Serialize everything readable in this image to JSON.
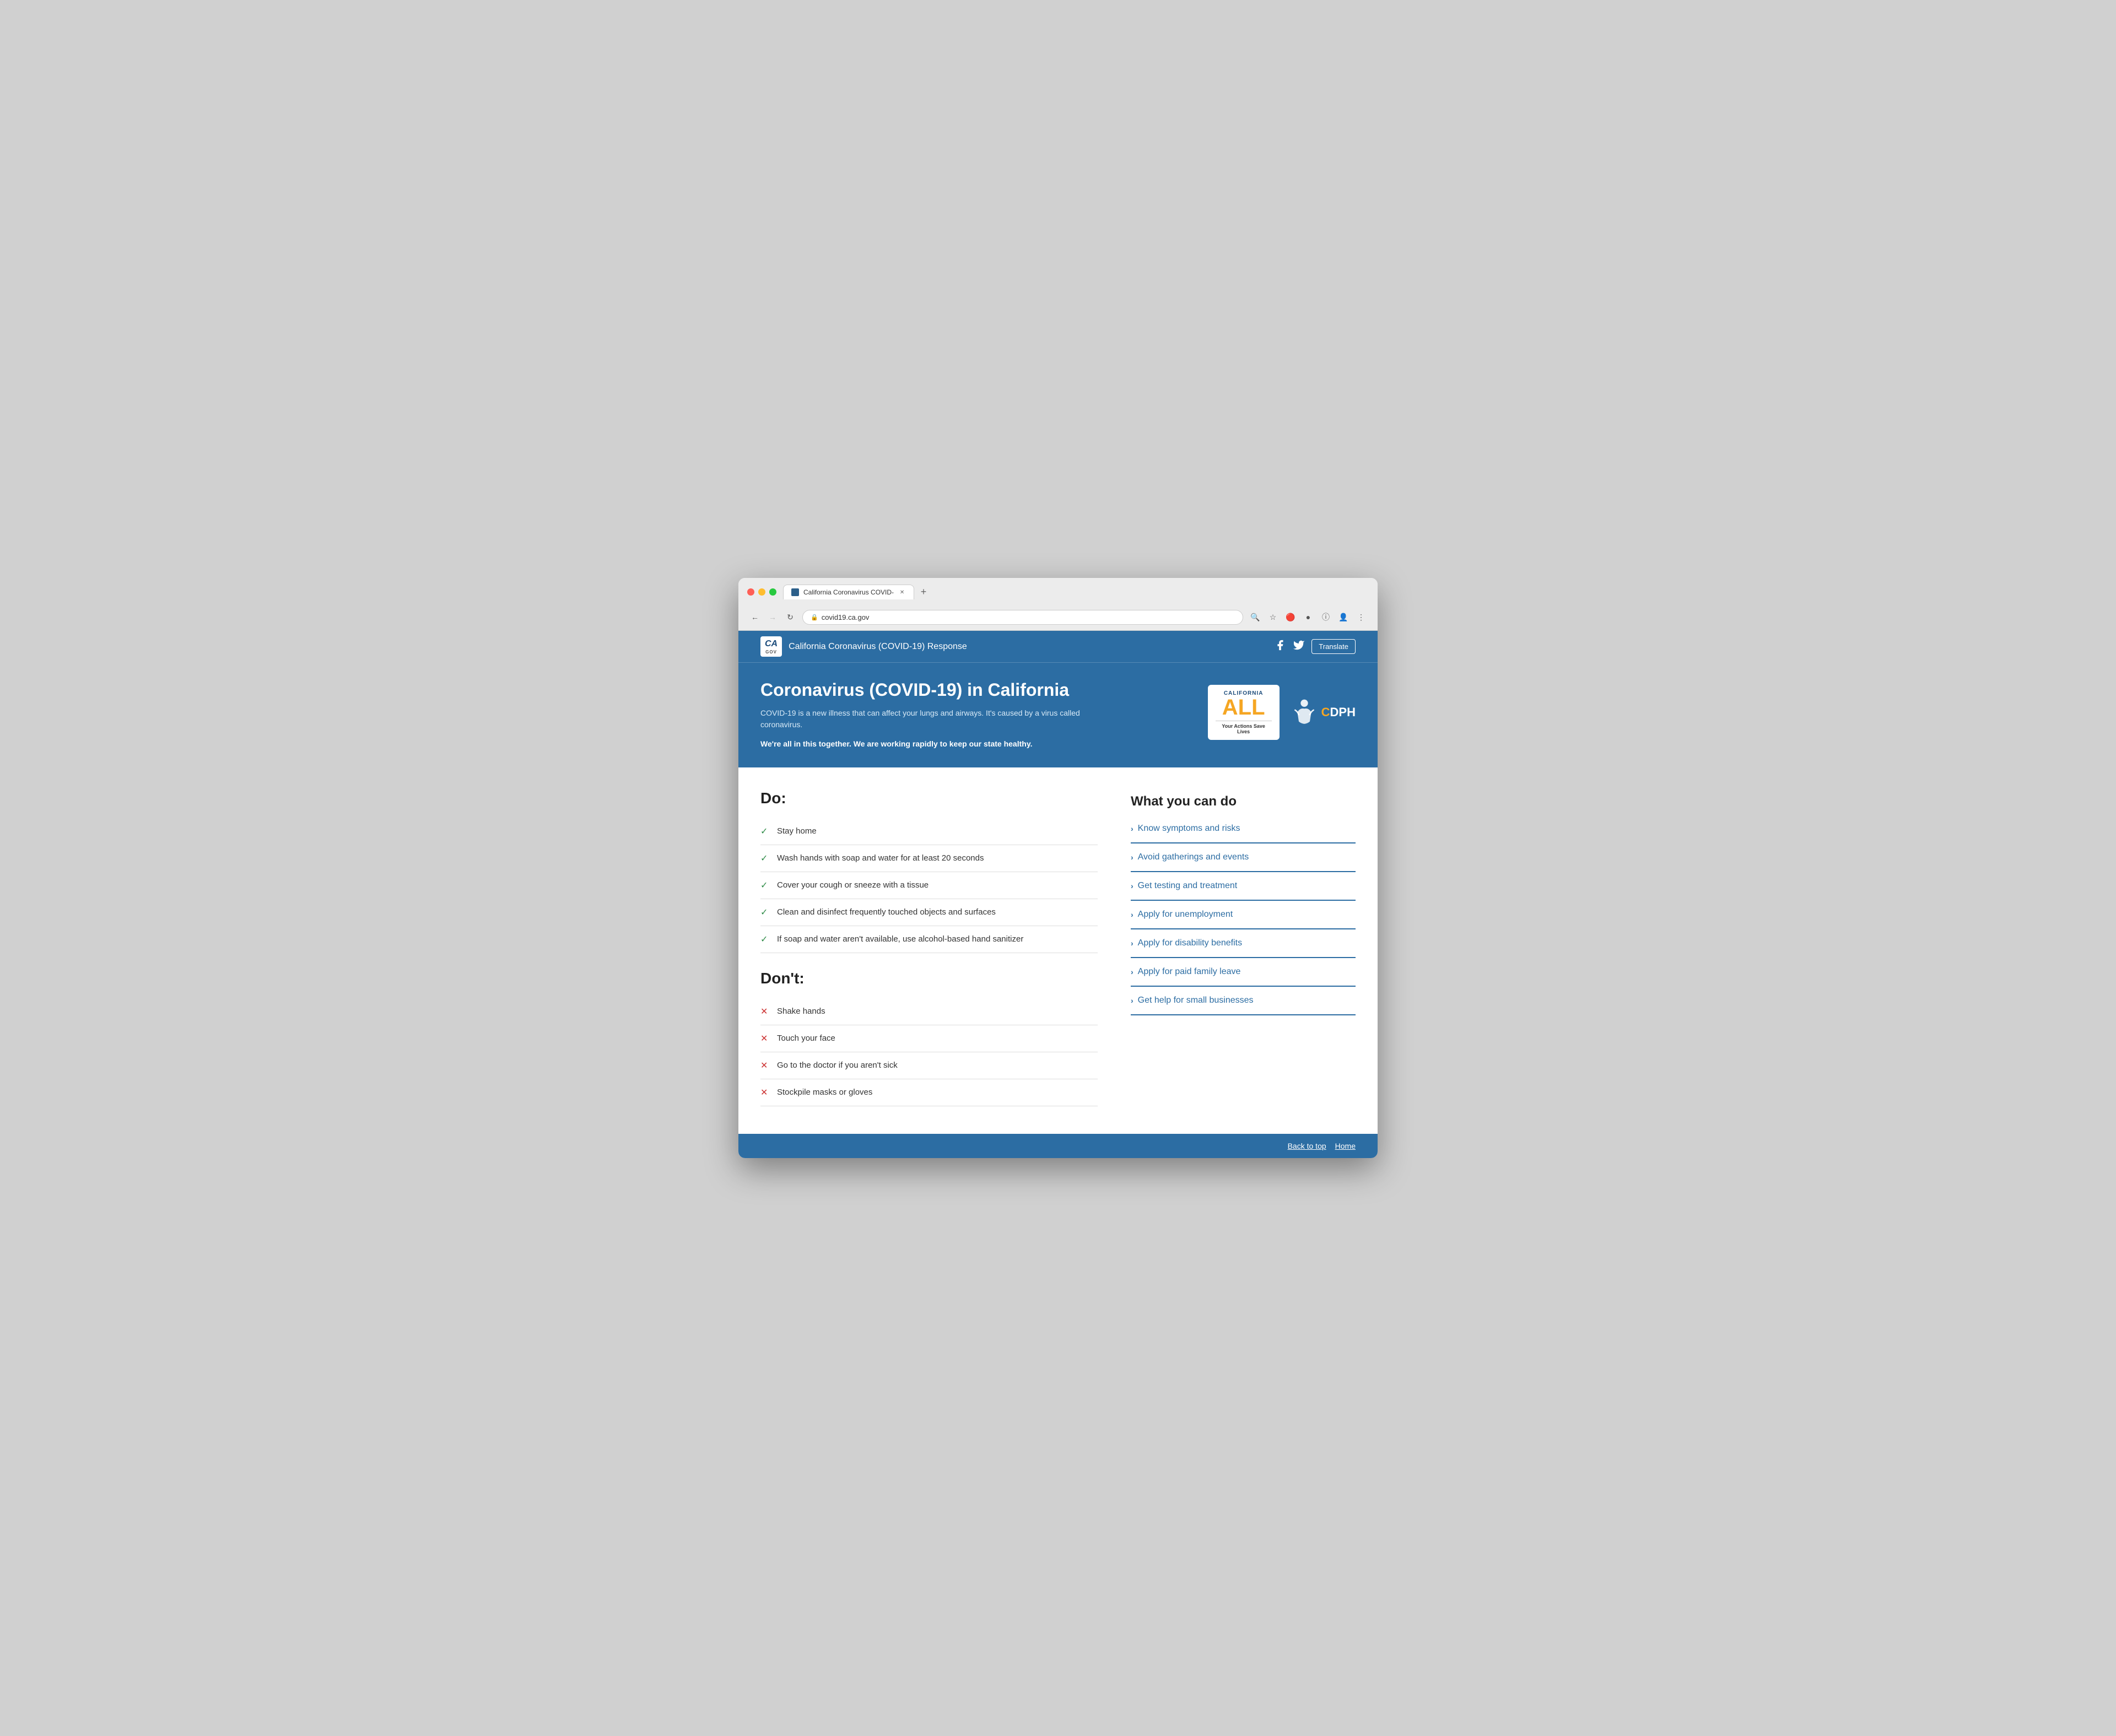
{
  "browser": {
    "tab_label": "California Coronavirus COVID-",
    "url": "covid19.ca.gov",
    "new_tab_label": "+",
    "back_label": "←",
    "forward_label": "→",
    "refresh_label": "↻"
  },
  "header": {
    "logo_ca": "CA",
    "logo_gov": "GOV",
    "site_name": "California Coronavirus (COVID-19) Response",
    "translate_label": "Translate",
    "facebook_icon": "f",
    "twitter_icon": "t"
  },
  "hero": {
    "title": "Coronavirus (COVID-19) in California",
    "description": "COVID-19 is a new illness that can affect your lungs and airways. It's caused by a virus called coronavirus.",
    "tagline": "We're all in this together. We are working rapidly to keep our state healthy.",
    "badge_california": "CALIFORNIA",
    "badge_all": "ALL",
    "badge_subtitle": "Your Actions Save Lives",
    "cdph_prefix": "C",
    "cdph_suffix": "DPH"
  },
  "do_section": {
    "title": "Do:",
    "items": [
      {
        "text": "Stay home",
        "type": "do"
      },
      {
        "text": "Wash hands with soap and water for at least 20 seconds",
        "type": "do"
      },
      {
        "text": "Cover your cough or sneeze with a tissue",
        "type": "do"
      },
      {
        "text": "Clean and disinfect frequently touched objects and surfaces",
        "type": "do"
      },
      {
        "text": "If soap and water aren't available, use alcohol-based hand sanitizer",
        "type": "do"
      }
    ]
  },
  "dont_section": {
    "title": "Don't:",
    "items": [
      {
        "text": "Shake hands",
        "type": "dont"
      },
      {
        "text": "Touch your face",
        "type": "dont"
      },
      {
        "text": "Go to the doctor if you aren't sick",
        "type": "dont"
      },
      {
        "text": "Stockpile masks or gloves",
        "type": "dont"
      }
    ]
  },
  "what_you_can_do": {
    "title": "What you can do",
    "links": [
      "Know symptoms and risks",
      "Avoid gatherings and events",
      "Get testing and treatment",
      "Apply for unemployment",
      "Apply for disability benefits",
      "Apply for paid family leave",
      "Get help for small businesses"
    ]
  },
  "footer": {
    "back_to_top": "Back to top",
    "home": "Home"
  }
}
